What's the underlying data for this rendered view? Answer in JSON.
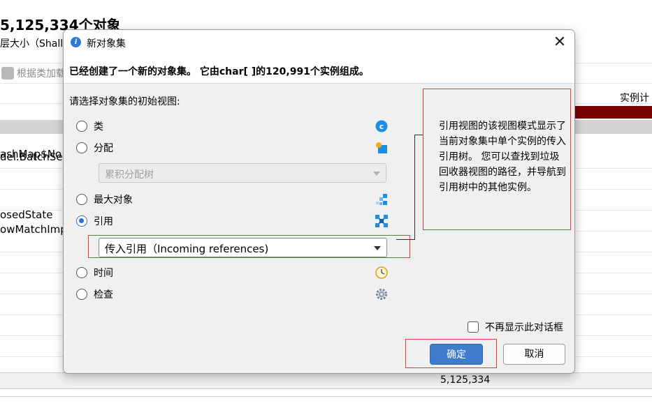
{
  "background": {
    "title": "5,125,334个对象",
    "subtitle": "层大小（Shallo",
    "toolbar_button": "根据类加载",
    "column_header": "实例计",
    "rows": [
      "del.BatchSen",
      "ashMap$No",
      "osedState",
      "owMatchImp"
    ],
    "total_value": "5,125,334",
    "bar_color": "#7a0000"
  },
  "dialog": {
    "title": "新对象集",
    "app_icon": "info-icon",
    "close_glyph": "✕",
    "header_message": "已经创建了一个新的对象集。 它由char[ ]的120,991个实例组成。",
    "prompt": "请选择对象集的初始视图:",
    "options": [
      {
        "label": "类",
        "icon": "class-icon",
        "selected": false
      },
      {
        "label": "分配",
        "icon": "allocation-icon",
        "selected": false
      },
      {
        "label": "最大对象",
        "icon": "largest-objects-icon",
        "selected": false
      },
      {
        "label": "引用",
        "icon": "references-icon",
        "selected": true
      },
      {
        "label": "时间",
        "icon": "clock-icon",
        "selected": false
      },
      {
        "label": "检查",
        "icon": "gear-icon",
        "selected": false
      }
    ],
    "allocation_combo": {
      "value": "累积分配树",
      "enabled": false
    },
    "references_combo": {
      "value": "传入引用（Incoming references)",
      "enabled": true
    },
    "description": "引用视图的该视图模式显示了当前对象集中单个实例的传入引用树。 您可以查找到垃圾回收器视图的路径，并导航到引用树中的其他实例。",
    "dont_show_label": "不再显示此对话框",
    "dont_show_checked": false,
    "ok_label": "确定",
    "cancel_label": "取消",
    "accent_color": "#3e7dcc",
    "highlight_color": "#e23a3a"
  }
}
